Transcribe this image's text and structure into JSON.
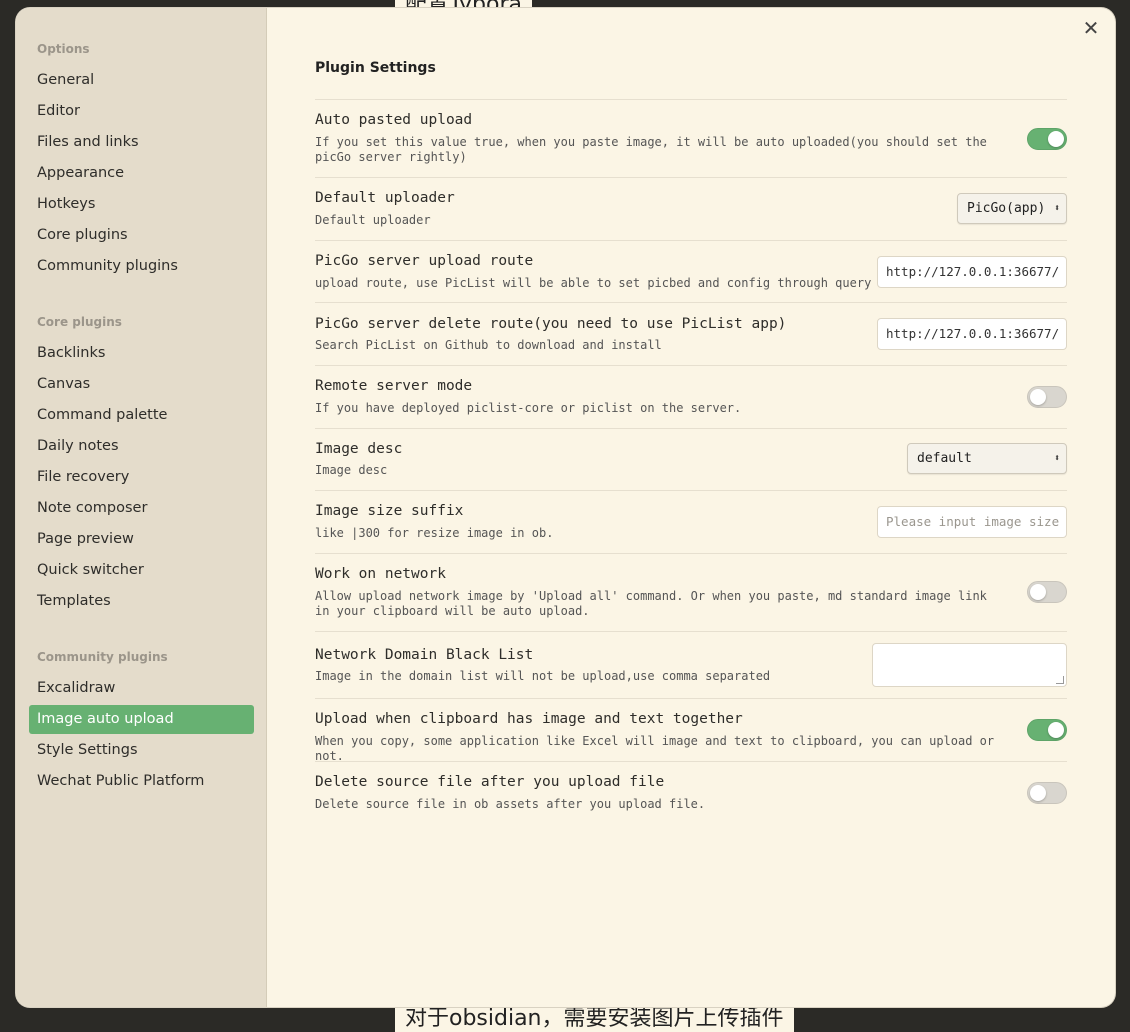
{
  "background": {
    "top_text": "配置Typora",
    "bottom_text": "对于obsidian，需要安装图片上传插件"
  },
  "sidebar": {
    "groups": [
      {
        "title": "Options",
        "items": [
          "General",
          "Editor",
          "Files and links",
          "Appearance",
          "Hotkeys",
          "Core plugins",
          "Community plugins"
        ]
      },
      {
        "title": "Core plugins",
        "items": [
          "Backlinks",
          "Canvas",
          "Command palette",
          "Daily notes",
          "File recovery",
          "Note composer",
          "Page preview",
          "Quick switcher",
          "Templates"
        ]
      },
      {
        "title": "Community plugins",
        "items": [
          "Excalidraw",
          "Image auto upload",
          "Style Settings",
          "Wechat Public Platform"
        ]
      }
    ],
    "active_item": "Image auto upload"
  },
  "colors": {
    "accent": "#67b172",
    "background": "#fbf5e5",
    "sidebar": "#e4dccb"
  },
  "close_icon": "close-icon",
  "content": {
    "title": "Plugin Settings",
    "settings": [
      {
        "name": "Auto pasted upload",
        "desc": "If you set this value true, when you paste image, it will be auto uploaded(you should set the picGo server rightly)",
        "control": "toggle",
        "checked": true
      },
      {
        "name": "Default uploader",
        "desc": "Default uploader",
        "control": "select",
        "value": "PicGo(app)"
      },
      {
        "name": "PicGo server upload route",
        "desc": "upload route, use PicList will be able to set picbed and config through query",
        "control": "text",
        "value": "http://127.0.0.1:36677/"
      },
      {
        "name": "PicGo server delete route(you need to use PicList app)",
        "desc": "Search PicList on Github to download and install",
        "control": "text",
        "value": "http://127.0.0.1:36677/"
      },
      {
        "name": "Remote server mode",
        "desc": "If you have deployed piclist-core or piclist on the server.",
        "control": "toggle",
        "checked": false
      },
      {
        "name": "Image desc",
        "desc": "Image desc",
        "control": "select",
        "value": "default"
      },
      {
        "name": "Image size suffix",
        "desc": "like |300 for resize image in ob.",
        "control": "text",
        "value": "",
        "placeholder": "Please input image size suffix"
      },
      {
        "name": "Work on network",
        "desc": "Allow upload network image by 'Upload all' command. Or when you paste, md standard image link in your clipboard will be auto upload.",
        "control": "toggle",
        "checked": false
      },
      {
        "name": "Network Domain Black List",
        "desc": "Image in the domain list will not be upload,use comma separated",
        "control": "textarea",
        "value": ""
      },
      {
        "name": "Upload when clipboard has image and text together",
        "desc": "When you copy, some application like Excel will image and text to clipboard, you can upload or not.",
        "control": "toggle",
        "checked": true
      },
      {
        "name": "Delete source file after you upload file",
        "desc": "Delete source file in ob assets after you upload file.",
        "control": "toggle",
        "checked": false
      }
    ]
  }
}
